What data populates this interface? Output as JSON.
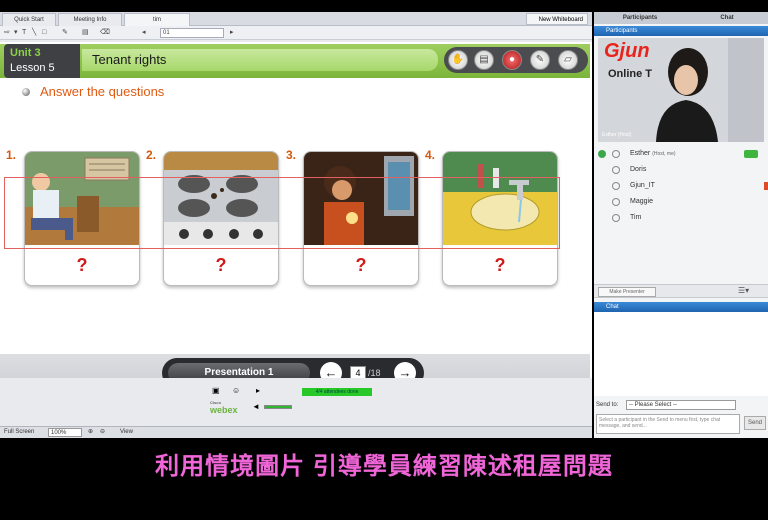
{
  "tabs": [
    {
      "label": "Quick Start"
    },
    {
      "label": "Meeting Info"
    },
    {
      "label": "tim"
    }
  ],
  "new_whiteboard_label": "New Whiteboard",
  "toolbar": {
    "page_field": "01"
  },
  "slide": {
    "unit": "Unit 3",
    "lesson": "Lesson 5",
    "title": "Tenant rights",
    "question_title": "Answer the questions",
    "cards": [
      {
        "number": "1.",
        "answer": "?"
      },
      {
        "number": "2.",
        "answer": "?"
      },
      {
        "number": "3.",
        "answer": "?"
      },
      {
        "number": "4.",
        "answer": "?"
      }
    ],
    "presentation_label": "Presentation 1",
    "current_page": "4",
    "total_pages": "/18"
  },
  "controls": {
    "status_text": "4/4 attendees done",
    "brand": "webex",
    "brand_small": "Cisco"
  },
  "bottom_bar": {
    "full_screen": "Full Screen",
    "zoom": "100%",
    "view": "View"
  },
  "right_panel": {
    "tab_participants": "Participants",
    "tab_chat": "Chat",
    "participants_header": "Participants",
    "video_brand": "Gjun",
    "video_sub": "Online T",
    "video_caption": "Esther (Host)",
    "participants": [
      {
        "name": "Esther",
        "host_note": "(Host, me)"
      },
      {
        "name": "Doris",
        "host_note": ""
      },
      {
        "name": "Gjun_IT",
        "host_note": ""
      },
      {
        "name": "Maggie",
        "host_note": ""
      },
      {
        "name": "Tim",
        "host_note": ""
      }
    ],
    "make_presenter": "Make Presenter",
    "chat_header": "Chat",
    "send_to_label": "Send to:",
    "send_to_value": "-- Please Select --",
    "chat_placeholder": "Select a participant in the Send to menu first, type chat message, and send...",
    "send_button": "Send"
  },
  "subtitle": "利用情境圖片 引導學員練習陳述租屋問題",
  "colors": {
    "accent_green": "#7cb53a",
    "question_orange": "#e05a12",
    "subtitle_pink": "#f065d8"
  }
}
